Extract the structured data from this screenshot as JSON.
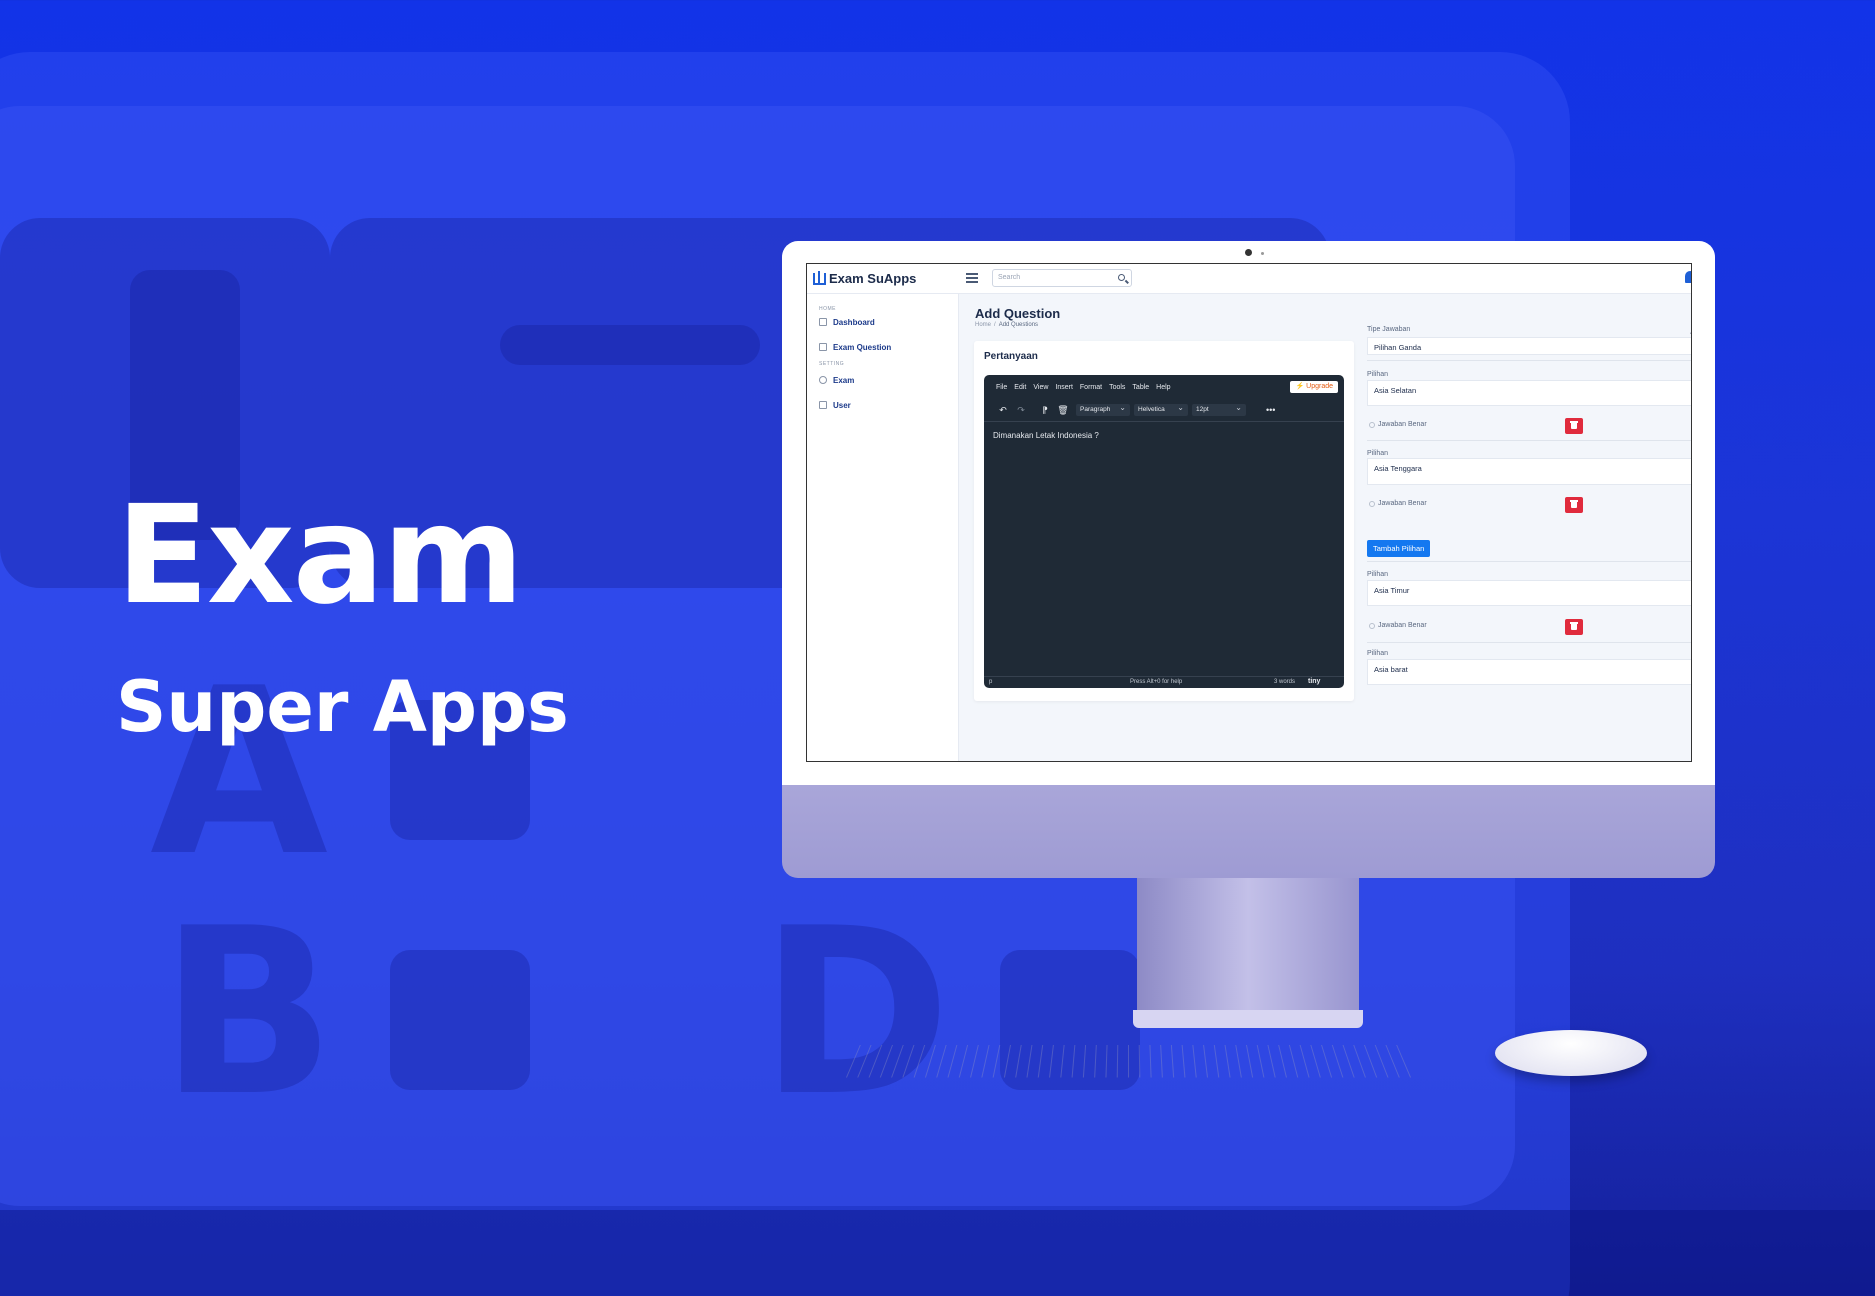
{
  "hero": {
    "title": "Exam",
    "subtitle": "Super Apps"
  },
  "background": {
    "letters": [
      "A",
      "B",
      "D"
    ]
  },
  "app": {
    "name": "Exam SuApps",
    "search_placeholder": "Search"
  },
  "sidebar": {
    "sections": [
      {
        "label": "HOME",
        "items": [
          {
            "label": "Dashboard",
            "icon": "grid-icon"
          },
          {
            "label": "Exam Question",
            "icon": "document-icon"
          }
        ]
      },
      {
        "label": "SETTING",
        "items": [
          {
            "label": "Exam",
            "icon": "person-icon"
          },
          {
            "label": "User",
            "icon": "users-icon"
          }
        ]
      }
    ]
  },
  "page": {
    "title": "Add Question",
    "breadcrumb": [
      "Home",
      "/",
      "Add Questions"
    ]
  },
  "question_card": {
    "title": "Pertanyaan",
    "editor": {
      "menu": [
        "File",
        "Edit",
        "View",
        "Insert",
        "Format",
        "Tools",
        "Table",
        "Help"
      ],
      "upgrade_label": "⚡ Upgrade",
      "block_format": "Paragraph",
      "font_family": "Helvetica",
      "font_size": "12pt",
      "content": "Dimanakan Letak Indonesia ?",
      "status_path": "p",
      "status_help": "Press Alt+0 for help",
      "status_words": "3 words",
      "brand": "tiny"
    }
  },
  "answers": {
    "type_label": "Tipe Jawaban",
    "type_value": "Pilihan Ganda",
    "truncated_label": "Ja",
    "option_label": "Pilihan",
    "correct_label": "Jawaban Benar",
    "add_label": "Tambah Pilihan",
    "options": [
      "Asia Selatan",
      "Asia Tenggara",
      "Asia Timur",
      "Asia barat"
    ]
  },
  "colors": {
    "background": "#1c35d6",
    "primary": "#1478f0",
    "danger": "#e02b3d",
    "editor_bg": "#1f2a36"
  }
}
